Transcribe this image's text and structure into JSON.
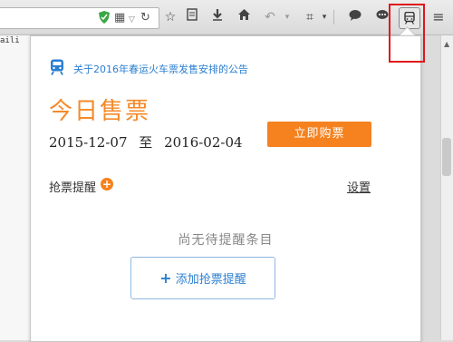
{
  "toolbar": {
    "url_icons": [
      "shield-icon",
      "qr-code-icon",
      "dropdown-arrow-icon",
      "reload-icon"
    ],
    "buttons": [
      "star-icon",
      "reading-list-icon",
      "download-icon",
      "home-icon",
      "undo-icon",
      "crop-icon",
      "chat-bubble-icon",
      "comment-icon",
      "train-icon",
      "menu-icon"
    ]
  },
  "left_strip_text": "aili",
  "panel": {
    "notice_link": "关于2016年春运火车票发售安排的公告",
    "title": "今日售票",
    "date_start": "2015-12-07",
    "date_sep": "至",
    "date_end": "2016-02-04",
    "buy_button": "立即购票",
    "reminder_label": "抢票提醒",
    "settings_link": "设置",
    "empty_text": "尚无待提醒条目",
    "add_button": "添加抢票提醒"
  },
  "colors": {
    "accent_orange": "#f5821f",
    "link_blue": "#2b7fd1",
    "highlight_red": "#e0161b"
  }
}
